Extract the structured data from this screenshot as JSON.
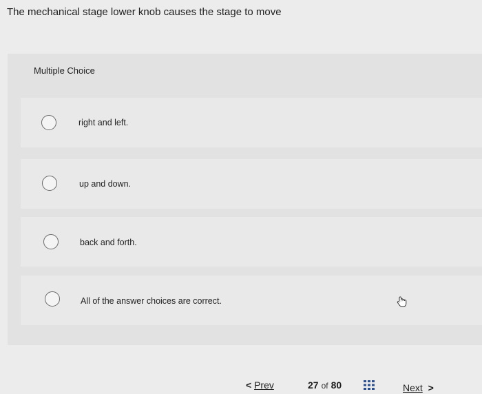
{
  "question": {
    "text": "The mechanical stage lower knob causes the stage to move"
  },
  "section": {
    "label": "Multiple Choice"
  },
  "choices": [
    {
      "label": "right and left."
    },
    {
      "label": "up and down."
    },
    {
      "label": "back and forth."
    },
    {
      "label": "All of the answer choices are correct."
    }
  ],
  "nav": {
    "prev_label": "Prev",
    "prev_icon": "chevron-left-icon",
    "current_page": "27",
    "of_label": "of",
    "total_pages": "80",
    "grid_icon": "grid-icon",
    "next_label": "Next",
    "next_icon": "chevron-right-icon"
  },
  "colors": {
    "accent": "#2c4f8a",
    "background": "#ececec"
  }
}
